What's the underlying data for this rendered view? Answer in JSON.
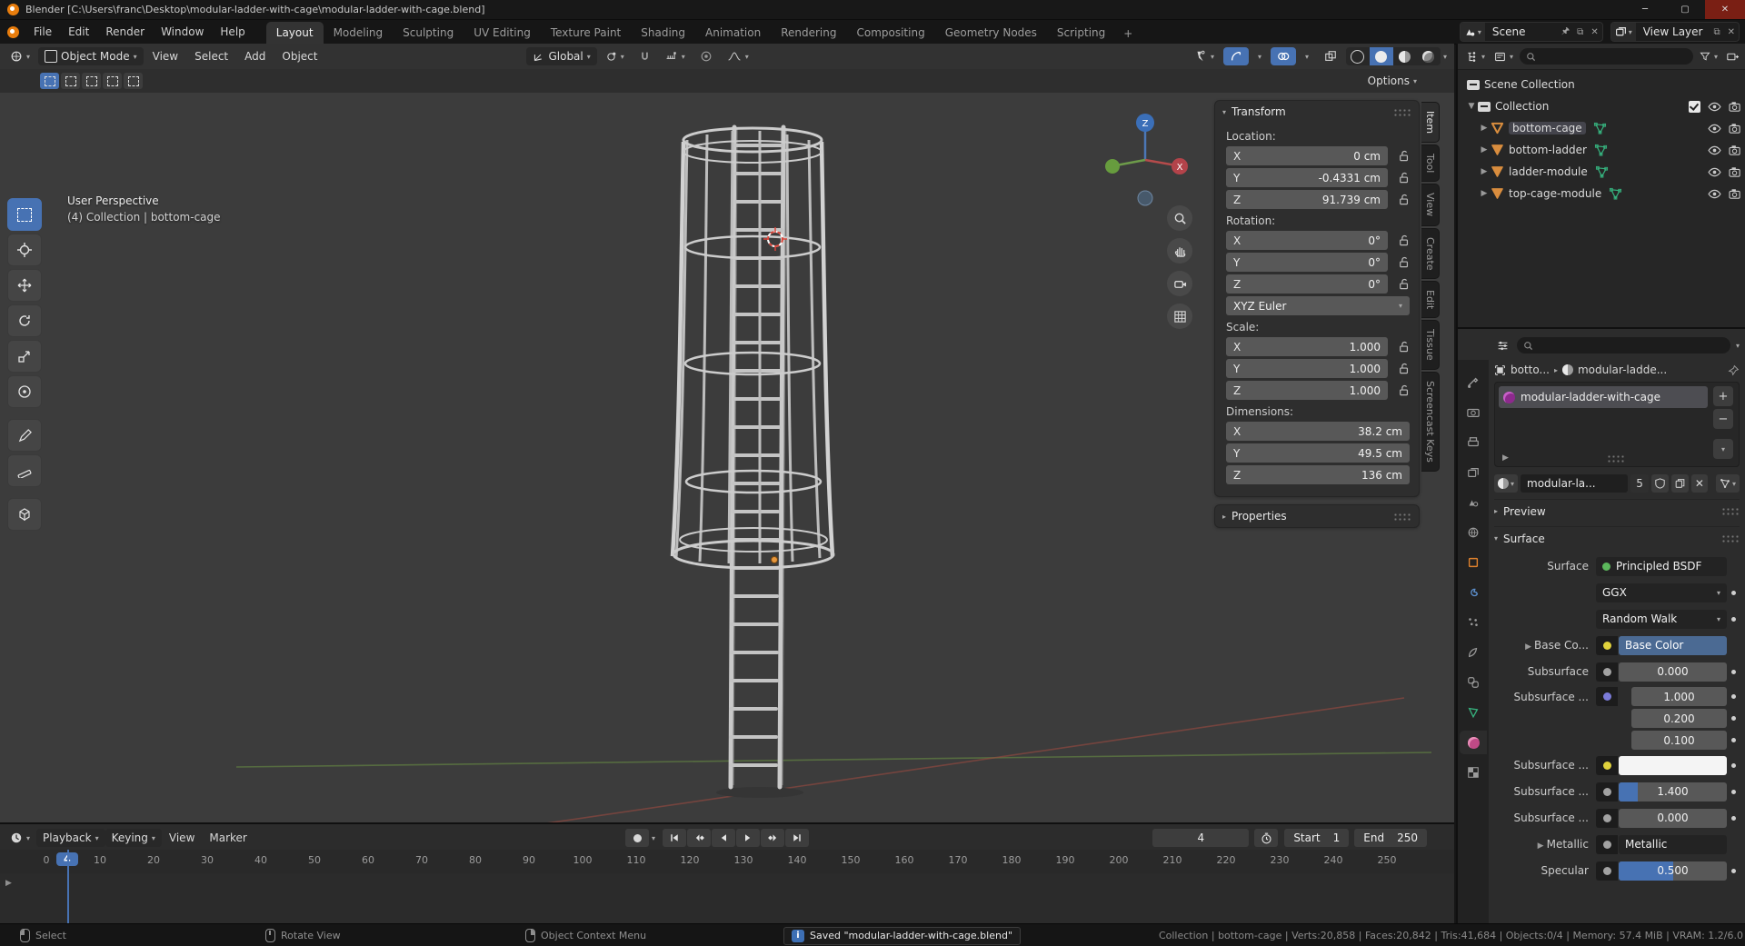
{
  "window": {
    "title": "Blender [C:\\Users\\franc\\Desktop\\modular-ladder-with-cage\\modular-ladder-with-cage.blend]",
    "minimize": "─",
    "maximize": "▢",
    "close": "✕"
  },
  "topbar": {
    "menus": [
      "File",
      "Edit",
      "Render",
      "Window",
      "Help"
    ],
    "workspaces": [
      "Layout",
      "Modeling",
      "Sculpting",
      "UV Editing",
      "Texture Paint",
      "Shading",
      "Animation",
      "Rendering",
      "Compositing",
      "Geometry Nodes",
      "Scripting"
    ],
    "new_workspace": "+",
    "scene_label": "Scene",
    "view_layer_label": "View Layer"
  },
  "viewport": {
    "header": {
      "mode": "Object Mode",
      "menus": [
        "View",
        "Select",
        "Add",
        "Object"
      ],
      "orientation": "Global",
      "options_label": "Options"
    },
    "overlay": {
      "perspective": "User Perspective",
      "context": "(4) Collection | bottom-cage"
    },
    "gizmo": {
      "z": "Z",
      "x": "X"
    }
  },
  "npanel": {
    "tabs": [
      "Item",
      "Tool",
      "View",
      "Create",
      "Edit",
      "Tissue",
      "Screencast Keys"
    ],
    "transform": {
      "title": "Transform",
      "location_label": "Location:",
      "rotation_label": "Rotation:",
      "scale_label": "Scale:",
      "dimensions_label": "Dimensions:",
      "rotation_mode": "XYZ Euler",
      "properties_label": "Properties",
      "axis_x": "X",
      "axis_y": "Y",
      "axis_z": "Z",
      "location": {
        "x": "0 cm",
        "y": "-0.4331 cm",
        "z": "91.739 cm"
      },
      "rotation": {
        "x": "0°",
        "y": "0°",
        "z": "0°"
      },
      "scale": {
        "x": "1.000",
        "y": "1.000",
        "z": "1.000"
      },
      "dimensions": {
        "x": "38.2 cm",
        "y": "49.5 cm",
        "z": "136 cm"
      }
    }
  },
  "outliner": {
    "scene_collection": "Scene Collection",
    "collection": "Collection",
    "items": [
      {
        "name": "bottom-cage"
      },
      {
        "name": "bottom-ladder"
      },
      {
        "name": "ladder-module"
      },
      {
        "name": "top-cage-module"
      }
    ]
  },
  "properties": {
    "breadcrumb_object": "botto...",
    "breadcrumb_material": "modular-ladde...",
    "slot_name": "modular-ladder-with-cage",
    "material_name": "modular-la...",
    "users_count": "5",
    "preview_label": "Preview",
    "surface_label": "Surface",
    "surface": {
      "surface_row_label": "Surface",
      "surface_value": "Principled BSDF",
      "distribution": "GGX",
      "subsurface_method": "Random Walk",
      "base_color_label": "Base Co...",
      "base_color_value": "Base Color",
      "subsurface_label": "Subsurface",
      "subsurface_value": "0.000",
      "subsurface_radius_label": "Subsurface ...",
      "radius_values": [
        "1.000",
        "0.200",
        "0.100"
      ],
      "subsurface_color_label": "Subsurface ...",
      "subsurface_ior_label": "Subsurface ...",
      "subsurface_ior": "1.400",
      "subsurface_aniso_label": "Subsurface ...",
      "subsurface_aniso": "0.000",
      "metallic_label": "Metallic",
      "metallic_value": "Metallic",
      "specular_label": "Specular",
      "specular_value": "0.500"
    }
  },
  "timeline": {
    "menus": [
      "Playback",
      "Keying",
      "View",
      "Marker"
    ],
    "current_frame": "4",
    "start_label": "Start",
    "start_value": "1",
    "end_label": "End",
    "end_value": "250",
    "ticks": [
      "0",
      "10",
      "20",
      "30",
      "40",
      "50",
      "60",
      "70",
      "80",
      "90",
      "100",
      "110",
      "120",
      "130",
      "140",
      "150",
      "160",
      "170",
      "180",
      "190",
      "200",
      "210",
      "220",
      "230",
      "240",
      "250"
    ]
  },
  "statusbar": {
    "select": "Select",
    "rotate_view": "Rotate View",
    "context_menu": "Object Context Menu",
    "saved": "Saved \"modular-ladder-with-cage.blend\"",
    "stats": "Collection | bottom-cage | Verts:20,858 | Faces:20,842 | Tris:41,684 | Objects:0/4 | Memory: 57.4 MiB | VRAM: 1.2/6.0"
  },
  "colors": {
    "accent": "#4772b3",
    "object_orange": "#e0822d",
    "data_green": "#36b27e",
    "material_pink": "#c04a86"
  }
}
